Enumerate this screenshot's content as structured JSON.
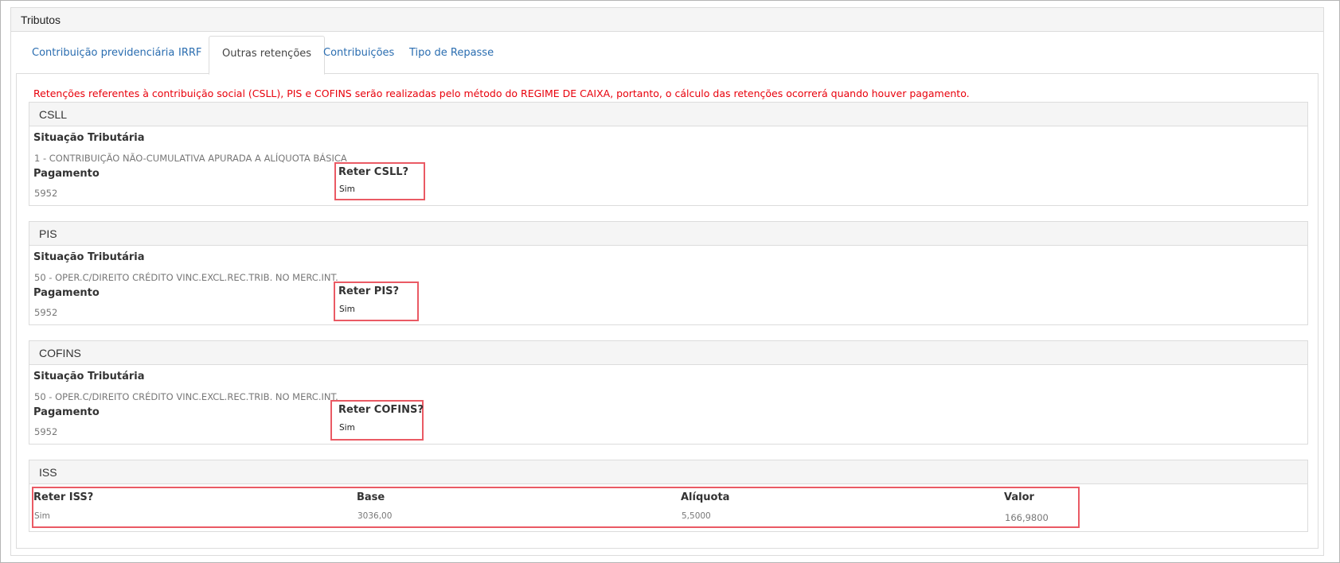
{
  "panel": {
    "title": "Tributos"
  },
  "tabs": [
    {
      "label": "Contribuição previdenciária"
    },
    {
      "label": "IRRF"
    },
    {
      "label": "Outras retenções"
    },
    {
      "label": "Contribuições"
    },
    {
      "label": "Tipo de Repasse"
    }
  ],
  "notice": "Retenções referentes à contribuição social (CSLL), PIS e COFINS serão realizadas pelo método do REGIME DE CAIXA, portanto, o cálculo das retenções ocorrerá quando houver pagamento.",
  "csll": {
    "title": "CSLL",
    "situacao_label": "Situação Tributária",
    "situacao_value": "1 - CONTRIBUIÇÃO NÃO-CUMULATIVA APURADA A ALÍQUOTA BÁSICA",
    "pagamento_label": "Pagamento",
    "pagamento_value": "5952",
    "reter_label": "Reter CSLL?",
    "reter_value": "Sim"
  },
  "pis": {
    "title": "PIS",
    "situacao_label": "Situação Tributária",
    "situacao_value": "50 - OPER.C/DIREITO CRÉDITO VINC.EXCL.REC.TRIB. NO MERC.INT.",
    "pagamento_label": "Pagamento",
    "pagamento_value": "5952",
    "reter_label": "Reter PIS?",
    "reter_value": "Sim"
  },
  "cofins": {
    "title": "COFINS",
    "situacao_label": "Situação Tributária",
    "situacao_value": "50 - OPER.C/DIREITO CRÉDITO VINC.EXCL.REC.TRIB. NO MERC.INT.",
    "pagamento_label": "Pagamento",
    "pagamento_value": "5952",
    "reter_label": "Reter COFINS?",
    "reter_value": "Sim"
  },
  "iss": {
    "title": "ISS",
    "reter_label": "Reter ISS?",
    "reter_value": "Sim",
    "base_label": "Base",
    "base_value": "3036,00",
    "aliquota_label": "Alíquota",
    "aliquota_value": "5,5000",
    "valor_label": "Valor",
    "valor_value": "166,9800"
  },
  "colors": {
    "link": "#2a6db0",
    "notice": "#e8000b",
    "highlight": "#ea5a64"
  }
}
